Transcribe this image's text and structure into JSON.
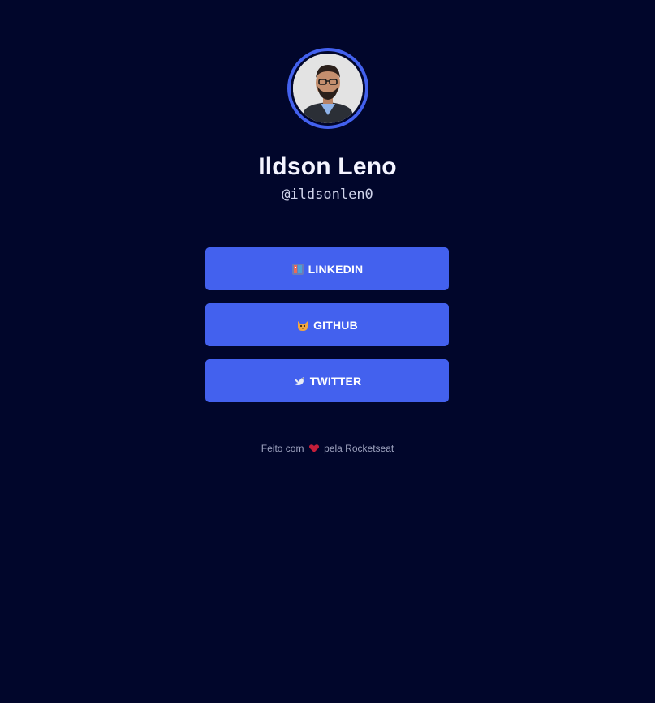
{
  "profile": {
    "name": "Ildson Leno",
    "handle": "@ildsonlen0"
  },
  "links": [
    {
      "label": "LINKEDIN",
      "icon": "briefcase-icon"
    },
    {
      "label": "GITHUB",
      "icon": "cat-icon"
    },
    {
      "label": "TWITTER",
      "icon": "bird-icon"
    }
  ],
  "footer": {
    "prefix": "Feito com",
    "suffix": "pela Rocketseat",
    "icon": "heart-icon"
  },
  "colors": {
    "background": "#01062b",
    "accent": "#4361ee",
    "heart": "#c41e3a"
  }
}
